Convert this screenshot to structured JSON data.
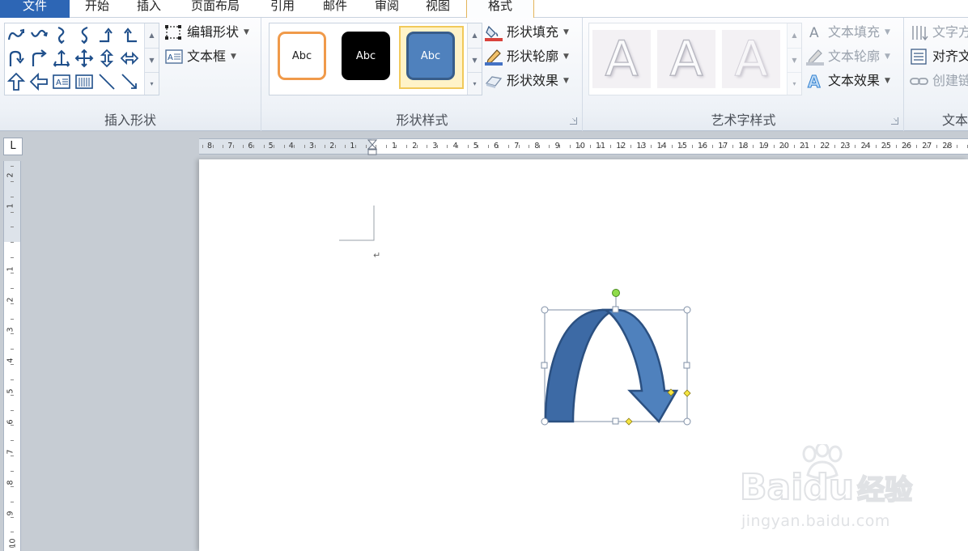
{
  "tabs": {
    "file": "文件",
    "home": "开始",
    "insert": "插入",
    "layout": "页面布局",
    "references": "引用",
    "mailings": "邮件",
    "review": "审阅",
    "view": "视图",
    "format": "格式"
  },
  "ribbon": {
    "insert_shapes": {
      "label": "插入形状",
      "edit_shape": "编辑形状",
      "text_box": "文本框"
    },
    "shape_styles": {
      "label": "形状样式",
      "presets": [
        {
          "text": "Abc",
          "fill": "#ffffff",
          "border": "#f09a4a",
          "color": "#1e1e1e"
        },
        {
          "text": "Abc",
          "fill": "#000000",
          "border": "#000000",
          "color": "#ffffff"
        },
        {
          "text": "Abc",
          "fill": "#4f81bd",
          "border": "#385d8a",
          "color": "#ffffff"
        }
      ],
      "shape_fill": "形状填充",
      "shape_outline": "形状轮廓",
      "shape_effects": "形状效果"
    },
    "wordart_styles": {
      "label": "艺术字样式",
      "letter": "A",
      "text_fill": "文本填充",
      "text_outline": "文本轮廓",
      "text_effects": "文本效果"
    },
    "text": {
      "label": "文本",
      "text_direction": "文字方向",
      "align_text": "对齐文本",
      "create_link": "创建链接"
    }
  },
  "ruler": {
    "corner": "L",
    "h_left": [
      "8",
      "7",
      "6",
      "5",
      "4",
      "3",
      "2",
      "1"
    ],
    "h_right": [
      "1",
      "2",
      "3",
      "4",
      "5",
      "6",
      "7",
      "8",
      "9",
      "10",
      "11",
      "12",
      "13",
      "14",
      "15",
      "16",
      "17",
      "18",
      "19",
      "20",
      "21",
      "22",
      "23",
      "24",
      "25",
      "26",
      "27",
      "28",
      "29"
    ],
    "v_top": [
      "2",
      "1"
    ],
    "v_main": [
      "1",
      "2",
      "3",
      "4",
      "5",
      "6",
      "7",
      "8",
      "9",
      "10"
    ]
  },
  "document": {
    "paragraph_mark": "↵"
  },
  "colors": {
    "accent": "#2d66b5",
    "arrow_fill": "#4f81bd",
    "arrow_stroke": "#385d8a",
    "selection_frame": "#7f8fa6"
  },
  "watermark": {
    "brand": "Bai",
    "brand2": "du",
    "brand_cn": "经验",
    "url": "jingyan.baidu.com"
  }
}
